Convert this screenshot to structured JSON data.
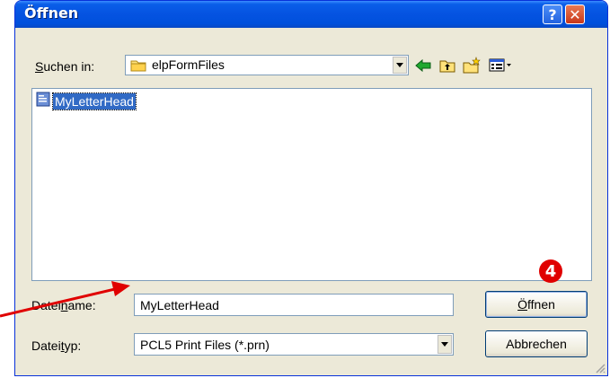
{
  "window": {
    "title": "Öffnen",
    "help_glyph": "?",
    "close_glyph": "✕"
  },
  "lookin": {
    "label_pre": "",
    "label_accel": "S",
    "label_post": "uchen in:",
    "value": "elpFormFiles"
  },
  "toolbar": {
    "icons": [
      "back-arrow-icon",
      "up-folder-icon",
      "new-folder-icon",
      "view-menu-icon"
    ]
  },
  "files": [
    {
      "name": "MyLetterHead",
      "icon": "document-icon",
      "selected": true
    }
  ],
  "filename": {
    "label_pre": "Datei",
    "label_accel": "n",
    "label_post": "ame:",
    "value": "MyLetterHead"
  },
  "filetype": {
    "label_pre": "Datei",
    "label_accel": "t",
    "label_post": "yp:",
    "value": "PCL5 Print Files (*.prn)"
  },
  "buttons": {
    "open_accel": "Ö",
    "open_post": "ffnen",
    "cancel": "Abbrechen"
  },
  "annotation": {
    "badge": "4",
    "arrow_color": "#e00000"
  },
  "colors": {
    "titlebar": "#0553e1",
    "selection": "#316ac5",
    "dialog_bg": "#ece9d8"
  }
}
